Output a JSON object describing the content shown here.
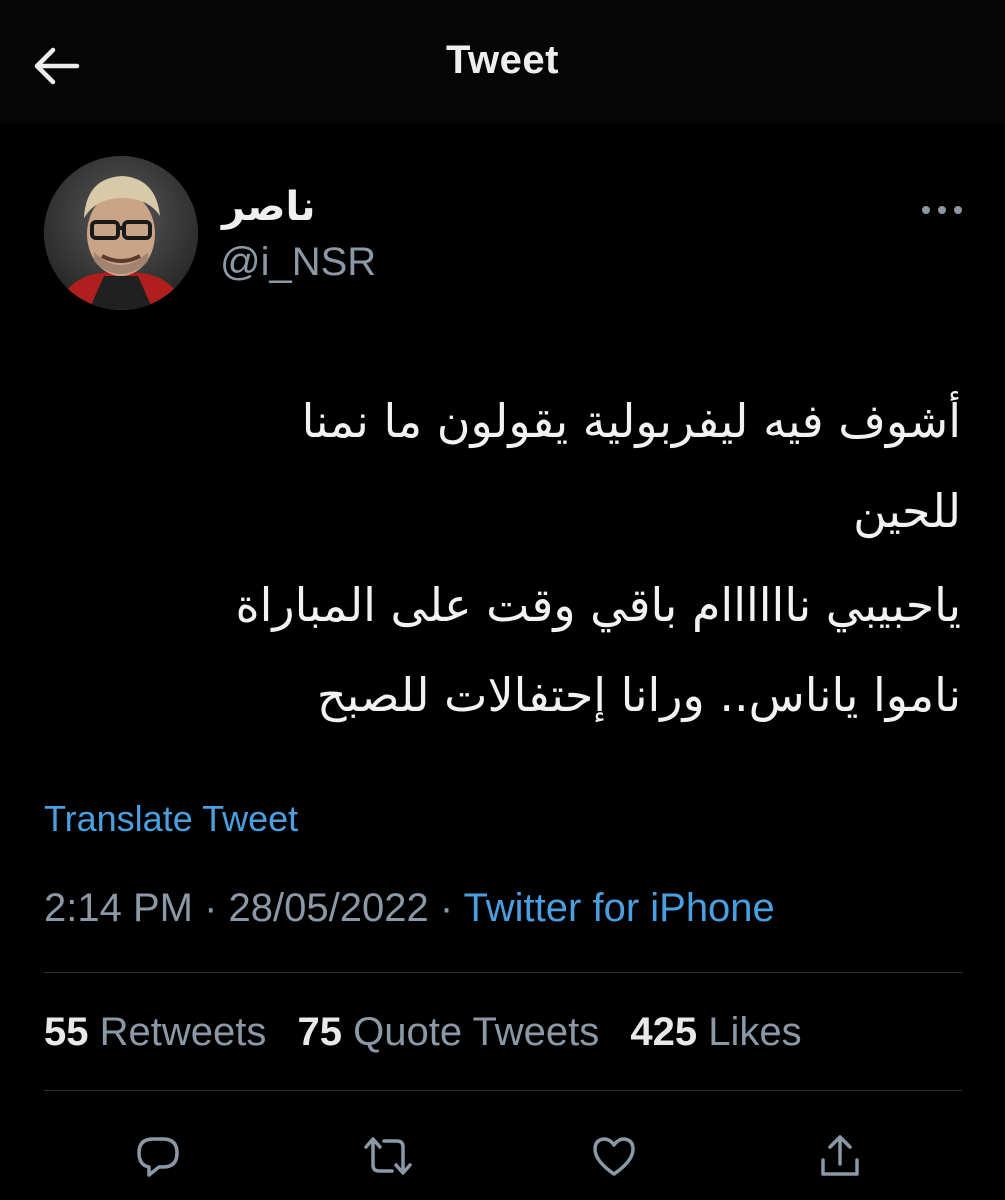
{
  "header": {
    "title": "Tweet",
    "back_icon": "arrow-left-icon"
  },
  "author": {
    "display_name": "ناصر",
    "handle": "@i_NSR",
    "avatar_icon": "profile-photo"
  },
  "more_icon": "more-horizontal-icon",
  "tweet": {
    "paragraphs": [
      "أشوف فيه ليفربولية يقولون ما نمنا\nللحين",
      "ياحبيبي نااااااام باقي وقت على المباراة\nناموا ياناس.. ورانا إحتفالات للصبح"
    ],
    "line1": "أشوف فيه ليفربولية يقولون ما نمنا",
    "line2": "للحين",
    "line3": "ياحبيبي ناااااام باقي وقت على المباراة",
    "line4": "ناموا ياناس.. ورانا إحتفالات للصبح"
  },
  "translate_label": "Translate Tweet",
  "meta": {
    "time": "2:14 PM",
    "separator": " · ",
    "date": "28/05/2022",
    "source": "Twitter for iPhone"
  },
  "stats": {
    "retweets_count": "55",
    "retweets_label": "Retweets",
    "quotes_count": "75",
    "quotes_label": "Quote Tweets",
    "likes_count": "425",
    "likes_label": "Likes"
  },
  "actions": {
    "reply_icon": "reply-icon",
    "retweet_icon": "retweet-icon",
    "like_icon": "heart-icon",
    "share_icon": "share-icon"
  },
  "colors": {
    "background": "#000000",
    "text": "#e7e9ea",
    "secondary": "#8b98a5",
    "link": "#4a9fe0",
    "divider": "#2f3336"
  }
}
